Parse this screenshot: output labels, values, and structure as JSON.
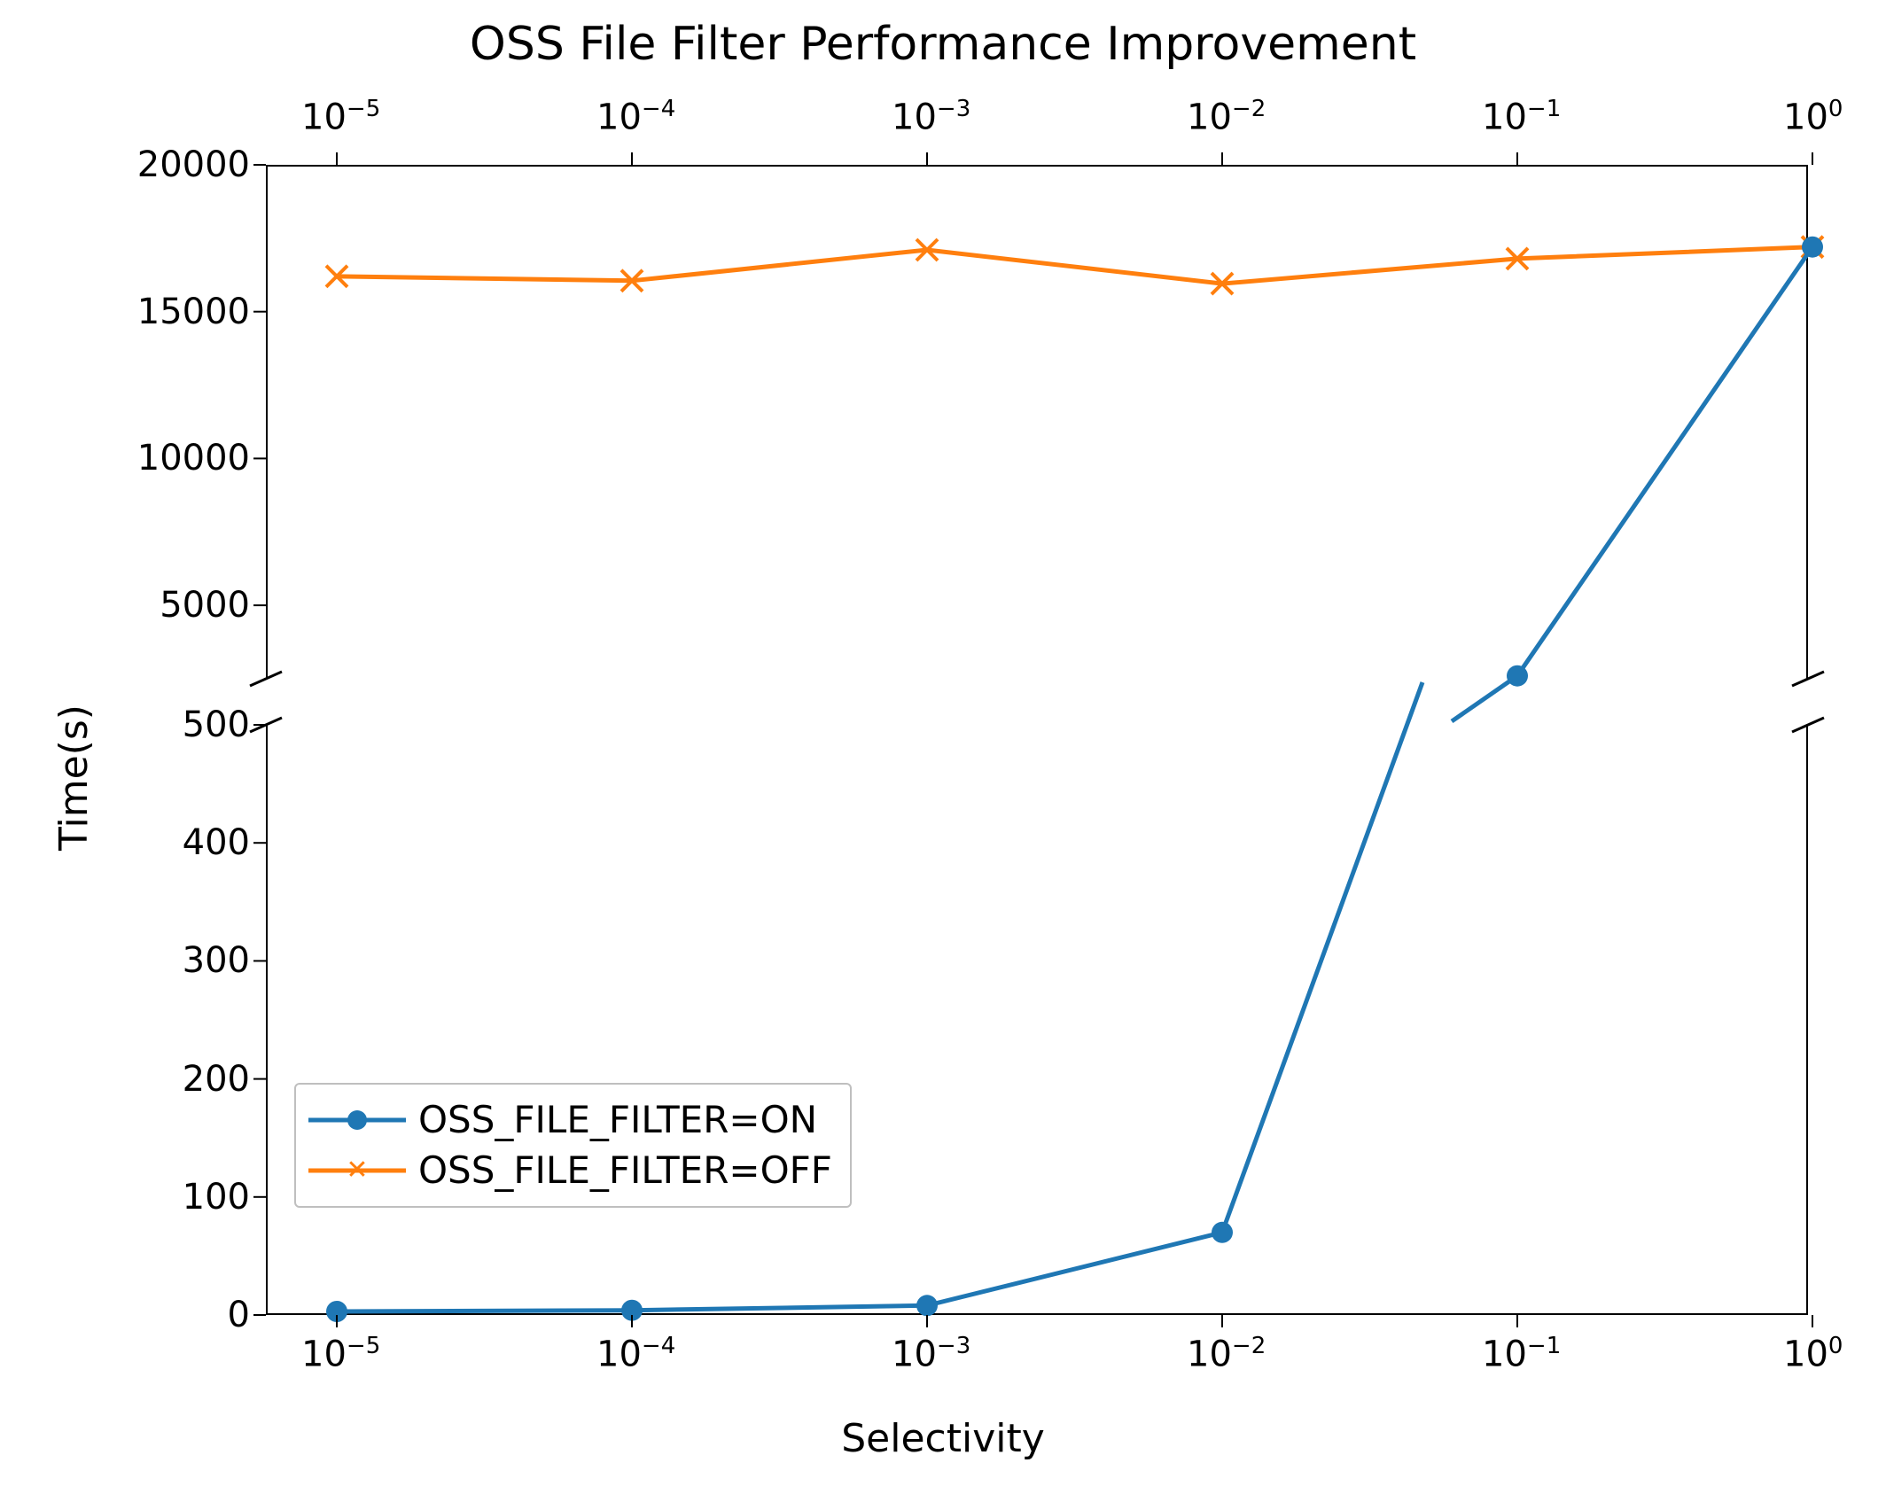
{
  "chart_data": {
    "type": "line",
    "title": "OSS File Filter Performance Improvement",
    "xlabel": "Selectivity",
    "ylabel": "Time(s)",
    "x_scale": "log",
    "x_values": [
      1e-05,
      0.0001,
      0.001,
      0.01,
      0.1,
      1.0
    ],
    "x_tick_labels": [
      "10⁻⁵",
      "10⁻⁴",
      "10⁻³",
      "10⁻²",
      "10⁻¹",
      "10⁰"
    ],
    "y_axis": {
      "broken": true,
      "lower_range": [
        0,
        500
      ],
      "lower_ticks": [
        0,
        100,
        200,
        300,
        400,
        500
      ],
      "upper_range": [
        2500,
        20000
      ],
      "upper_ticks": [
        5000,
        10000,
        15000,
        20000
      ]
    },
    "series": [
      {
        "name": "OSS_FILE_FILTER=ON",
        "marker": "circle",
        "color": "#1f77b4",
        "values": [
          3,
          4,
          8,
          70,
          2600,
          17200
        ]
      },
      {
        "name": "OSS_FILE_FILTER=OFF",
        "marker": "x",
        "color": "#ff7f0e",
        "values": [
          16200,
          16050,
          17100,
          15950,
          16800,
          17200
        ]
      }
    ],
    "legend_position": "lower-left-inside"
  },
  "title": "OSS File Filter Performance Improvement",
  "ylabel": "Time(s)",
  "xlabel": "Selectivity",
  "x_ticks_html": [
    "10<sup>−5</sup>",
    "10<sup>−4</sup>",
    "10<sup>−3</sup>",
    "10<sup>−2</sup>",
    "10<sup>−1</sup>",
    "10<sup>0</sup>"
  ],
  "y_ticks_lower": [
    "0",
    "100",
    "200",
    "300",
    "400",
    "500"
  ],
  "y_ticks_upper": [
    "5000",
    "10000",
    "15000",
    "20000"
  ],
  "legend": {
    "on": "OSS_FILE_FILTER=ON",
    "off": "OSS_FILE_FILTER=OFF"
  },
  "colors": {
    "on": "#1f77b4",
    "off": "#ff7f0e"
  }
}
